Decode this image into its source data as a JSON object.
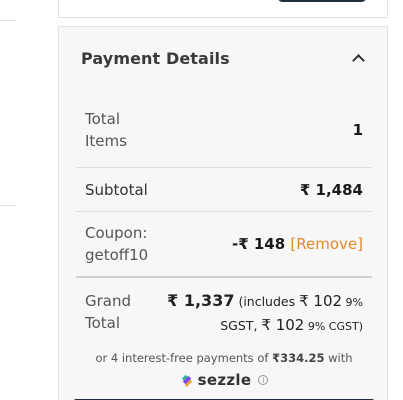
{
  "payment": {
    "title": "Payment Details",
    "rows": {
      "total_items": {
        "label": "Total Items",
        "value": "1"
      },
      "subtotal": {
        "label": "Subtotal",
        "value": "₹ 1,484"
      },
      "coupon": {
        "label": "Coupon: getoff10",
        "value": "-₹ 148",
        "remove": "[Remove]"
      },
      "grand_total": {
        "label": "Grand Total",
        "amount": "₹ 1,337",
        "includes_prefix": "(includes ",
        "sgst_amount": "₹ 102",
        "sgst_label": " 9%",
        "sgst_text": "SGST, ",
        "cgst_amount": "₹ 102",
        "cgst_label": " 9% CGST)"
      }
    },
    "installments": {
      "prefix": "or 4 interest-free payments of ",
      "amount": "₹334.25",
      "suffix": " with"
    },
    "sezzle": {
      "brand": "sezzle",
      "info_glyph": "i"
    }
  },
  "icons": {
    "collapse": "chevron-up-icon",
    "sezzle": "sezzle-logo-icon",
    "info": "info-icon"
  },
  "colors": {
    "accent": "#e08a2a",
    "dark": "#1f2d3d",
    "panel_bg": "#f7f7f7"
  }
}
